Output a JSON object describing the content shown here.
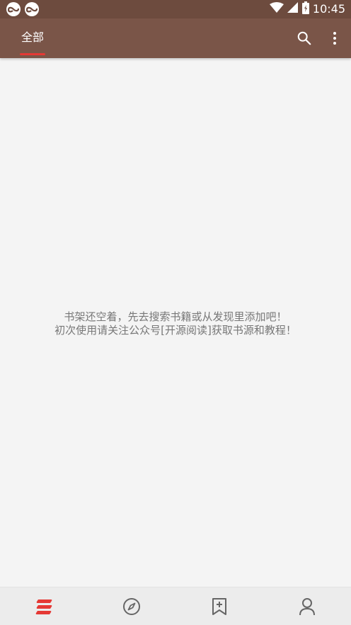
{
  "status_bar": {
    "time": "10:45",
    "notification_icons": [
      "app-notification-icon",
      "app-notification-icon"
    ],
    "system_icons": [
      "wifi-icon",
      "cell-signal-icon",
      "battery-icon"
    ]
  },
  "app_bar": {
    "tabs": [
      {
        "label": "全部",
        "active": true
      }
    ],
    "actions": [
      "search-icon",
      "more-vert-icon"
    ]
  },
  "empty_state": {
    "line1": "书架还空着，先去搜索书籍或从发现里添加吧！",
    "line2": "初次使用请关注公众号[开源阅读]获取书源和教程！"
  },
  "bottom_nav": {
    "items": [
      {
        "icon": "bookshelf-icon",
        "active": true
      },
      {
        "icon": "compass-icon",
        "active": false
      },
      {
        "icon": "bookmark-add-icon",
        "active": false
      },
      {
        "icon": "person-icon",
        "active": false
      }
    ]
  },
  "colors": {
    "status_bar": "#6d4b3e",
    "app_bar": "#7a5548",
    "accent": "#e53935",
    "background": "#f4f4f4",
    "text_secondary": "#777777",
    "nav_icon": "#666666"
  }
}
